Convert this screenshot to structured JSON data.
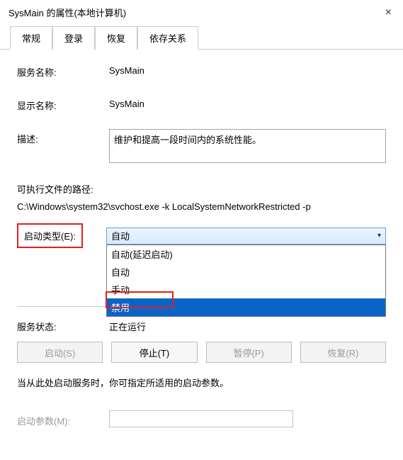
{
  "title": "SysMain 的属性(本地计算机)",
  "tabs": {
    "general": "常规",
    "logon": "登录",
    "recovery": "恢复",
    "deps": "依存关系"
  },
  "labels": {
    "service_name": "服务名称:",
    "display_name": "显示名称:",
    "description": "描述:",
    "exec_path": "可执行文件的路径:",
    "startup_type": "启动类型(E):",
    "service_status": "服务状态:",
    "startup_params": "启动参数(M):",
    "hint": "当从此处启动服务时，你可指定所适用的启动参数。"
  },
  "values": {
    "service_name": "SysMain",
    "display_name": "SysMain",
    "description": "维护和提高一段时间内的系统性能。",
    "exec_path": "C:\\Windows\\system32\\svchost.exe -k LocalSystemNetworkRestricted -p",
    "startup_selected": "自动",
    "service_status": "正在运行",
    "startup_params": ""
  },
  "startup_options": {
    "auto_delayed": "自动(延迟启动)",
    "auto": "自动",
    "manual": "手动",
    "disabled": "禁用"
  },
  "buttons": {
    "start": "启动(S)",
    "stop": "停止(T)",
    "pause": "暂停(P)",
    "resume": "恢复(R)"
  }
}
